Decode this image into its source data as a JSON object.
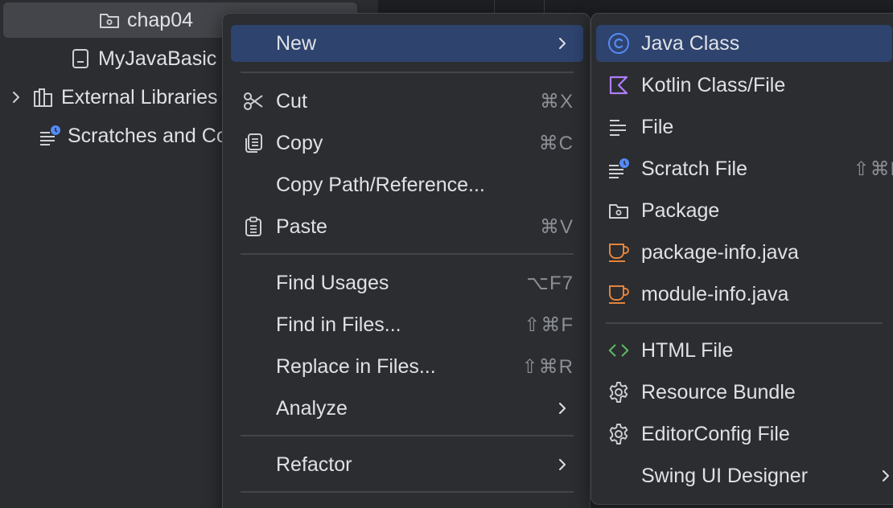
{
  "project_tree": {
    "items": [
      {
        "label": "chap04",
        "icon": "package-folder-icon"
      },
      {
        "label": "MyJavaBasic",
        "icon": "module-file-icon"
      },
      {
        "label": "External Libraries",
        "icon": "libraries-icon"
      },
      {
        "label": "Scratches and Consoles",
        "icon": "scratches-icon"
      }
    ]
  },
  "context_menu": {
    "items": [
      {
        "label": "New",
        "shortcut": "",
        "submenu": true
      },
      {
        "label": "Cut",
        "shortcut": "⌘X",
        "icon": "scissors-icon"
      },
      {
        "label": "Copy",
        "shortcut": "⌘C",
        "icon": "copy-icon"
      },
      {
        "label": "Copy Path/Reference...",
        "shortcut": ""
      },
      {
        "label": "Paste",
        "shortcut": "⌘V",
        "icon": "clipboard-icon"
      },
      {
        "label": "Find Usages",
        "shortcut": "⌥F7"
      },
      {
        "label": "Find in Files...",
        "shortcut": "⇧⌘F"
      },
      {
        "label": "Replace in Files...",
        "shortcut": "⇧⌘R"
      },
      {
        "label": "Analyze",
        "shortcut": "",
        "submenu": true
      },
      {
        "label": "Refactor",
        "shortcut": "",
        "submenu": true
      }
    ]
  },
  "new_submenu": {
    "items": [
      {
        "label": "Java Class",
        "icon": "java-class-icon"
      },
      {
        "label": "Kotlin Class/File",
        "icon": "kotlin-icon"
      },
      {
        "label": "File",
        "icon": "file-lines-icon"
      },
      {
        "label": "Scratch File",
        "shortcut": "⇧⌘N",
        "icon": "scratch-file-icon"
      },
      {
        "label": "Package",
        "icon": "package-icon"
      },
      {
        "label": "package-info.java",
        "icon": "java-cup-icon"
      },
      {
        "label": "module-info.java",
        "icon": "java-cup-icon"
      },
      {
        "label": "HTML File",
        "icon": "html-icon"
      },
      {
        "label": "Resource Bundle",
        "icon": "gear-icon"
      },
      {
        "label": "EditorConfig File",
        "icon": "gear-icon"
      },
      {
        "label": "Swing UI Designer",
        "submenu": true
      }
    ]
  },
  "colors": {
    "background": "#2b2d30",
    "highlight": "#2e436e",
    "text": "#dfe1e5",
    "shortcut_text": "#8c8f96",
    "java_class_blue": "#548af7",
    "kotlin_purple": "#b07dfa",
    "java_orange": "#e5833c",
    "html_green": "#5fb865"
  }
}
